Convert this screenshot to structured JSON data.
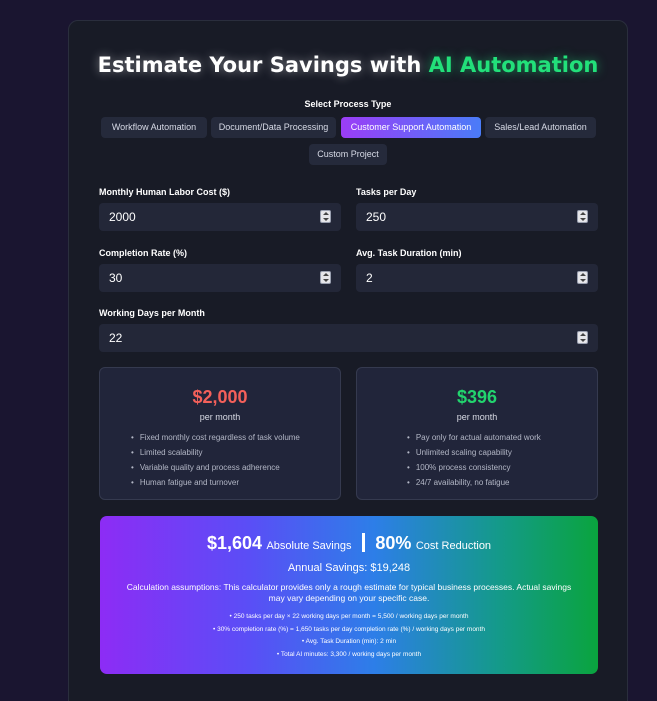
{
  "title": {
    "main": "Estimate Your Savings with ",
    "highlight": "AI Automation"
  },
  "process": {
    "label": "Select Process Type",
    "types": [
      "Workflow Automation",
      "Document/Data Processing",
      "Customer Support Automation",
      "Sales/Lead Automation",
      "Custom Project"
    ],
    "selected": "Customer Support Automation"
  },
  "fields": {
    "labor_cost": {
      "label": "Monthly Human Labor Cost ($)",
      "value": "2000"
    },
    "tasks_per_day": {
      "label": "Tasks per Day",
      "value": "250"
    },
    "completion_rate": {
      "label": "Completion Rate (%)",
      "value": "30"
    },
    "task_duration": {
      "label": "Avg. Task Duration (min)",
      "value": "2"
    },
    "working_days": {
      "label": "Working Days per Month",
      "value": "22"
    }
  },
  "human": {
    "amount": "$2,000",
    "per": "per month",
    "color": "#f4605a",
    "bullets": [
      "Fixed monthly cost regardless of task volume",
      "Limited scalability",
      "Variable quality and process adherence",
      "Human fatigue and turnover"
    ]
  },
  "ai": {
    "amount": "$396",
    "per": "per month",
    "color": "#22d46e",
    "bullets": [
      "Pay only for actual automated work",
      "Unlimited scaling capability",
      "100% process consistency",
      "24/7 availability, no fatigue"
    ]
  },
  "savings": {
    "absolute_value": "$1,604",
    "absolute_label": "Absolute Savings",
    "reduction_value": "80%",
    "reduction_label": "Cost Reduction",
    "annual": "Annual Savings: $19,248",
    "assumptions": "Calculation assumptions: This calculator provides only a rough estimate for typical business processes. Actual savings may vary depending on your specific case.",
    "lines": [
      "• 250 tasks per day × 22 working days per month = 5,500 / working days per month",
      "• 30% completion rate (%) = 1,650 tasks per day completion rate (%) / working days per month",
      "• Avg. Task Duration (min): 2 min",
      "• Total AI minutes: 3,300 / working days per month"
    ]
  },
  "colors": {
    "accent_green": "#22e07a",
    "accent_purple": "#9b3df7",
    "accent_blue": "#4a7cf8"
  }
}
